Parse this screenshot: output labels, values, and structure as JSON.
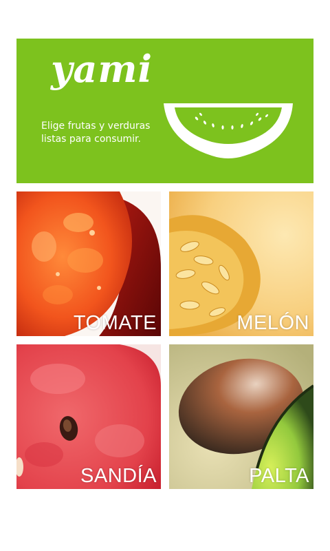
{
  "header": {
    "logo_text": "yami",
    "tagline": "Elige frutas y verduras listas para consumir.",
    "background_color": "#7dc21e",
    "icon": "melon-slice-icon"
  },
  "tiles": [
    {
      "label": "TOMATE",
      "image": "tomato-photo"
    },
    {
      "label": "MELÓN",
      "image": "melon-photo"
    },
    {
      "label": "SANDÍA",
      "image": "watermelon-photo"
    },
    {
      "label": "PALTA",
      "image": "avocado-photo"
    }
  ]
}
